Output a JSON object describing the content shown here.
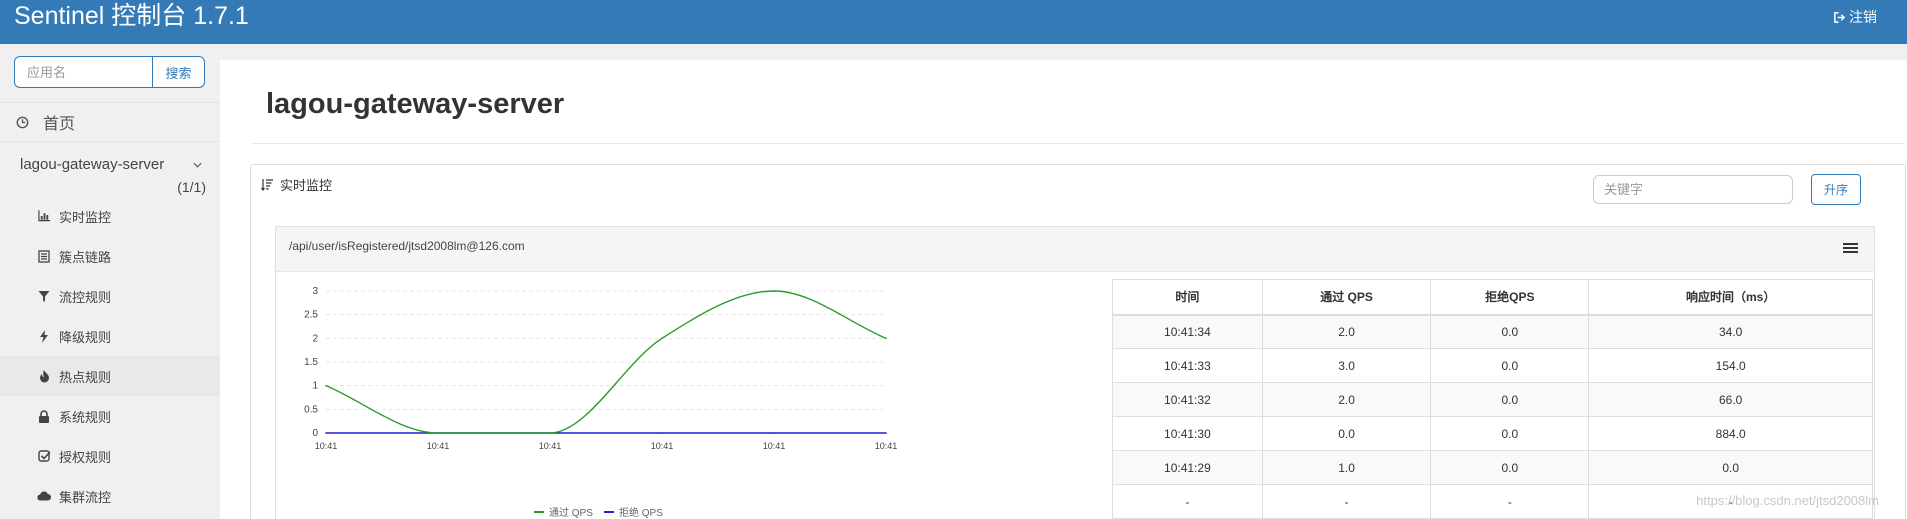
{
  "header": {
    "title": "Sentinel 控制台 1.7.1",
    "logout": "注销"
  },
  "sidebar": {
    "search_placeholder": "应用名",
    "search_button": "搜索",
    "home": "首页",
    "app": {
      "name": "lagou-gateway-server",
      "count": "(1/1)"
    },
    "items": [
      {
        "label": "实时监控",
        "icon": "bar-chart-icon"
      },
      {
        "label": "簇点链路",
        "icon": "list-icon"
      },
      {
        "label": "流控规则",
        "icon": "filter-icon"
      },
      {
        "label": "降级规则",
        "icon": "flash-icon"
      },
      {
        "label": "热点规则",
        "icon": "fire-icon"
      },
      {
        "label": "系统规则",
        "icon": "lock-icon"
      },
      {
        "label": "授权规则",
        "icon": "check-icon"
      },
      {
        "label": "集群流控",
        "icon": "cloud-icon"
      }
    ]
  },
  "main": {
    "title": "lagou-gateway-server",
    "panel_title": "实时监控",
    "keyword_placeholder": "关键字",
    "sort_button": "升序",
    "resource": "/api/user/isRegistered/jtsd2008lm@126.com"
  },
  "chart_data": {
    "type": "line",
    "x": [
      "10:41",
      "10:41",
      "10:41",
      "10:41",
      "10:41",
      "10:41"
    ],
    "ylim": [
      0,
      3
    ],
    "yticks": [
      "0",
      "0.5",
      "1",
      "1.5",
      "2",
      "2.5",
      "3"
    ],
    "series": [
      {
        "name": "通过 QPS",
        "color": "#2a9a2a",
        "values": [
          1,
          0,
          0,
          2,
          3,
          2
        ]
      },
      {
        "name": "拒绝 QPS",
        "color": "#1f1fd6",
        "values": [
          0,
          0,
          0,
          0,
          0,
          0
        ]
      }
    ]
  },
  "table": {
    "headers": [
      "时间",
      "通过 QPS",
      "拒绝QPS",
      "响应时间（ms）"
    ],
    "rows": [
      [
        "10:41:34",
        "2.0",
        "0.0",
        "34.0"
      ],
      [
        "10:41:33",
        "3.0",
        "0.0",
        "154.0"
      ],
      [
        "10:41:32",
        "2.0",
        "0.0",
        "66.0"
      ],
      [
        "10:41:30",
        "0.0",
        "0.0",
        "884.0"
      ],
      [
        "10:41:29",
        "1.0",
        "0.0",
        "0.0"
      ],
      [
        "-",
        "-",
        "-",
        "-"
      ]
    ]
  },
  "watermark": "https://blog.csdn.net/jtsd2008lm"
}
